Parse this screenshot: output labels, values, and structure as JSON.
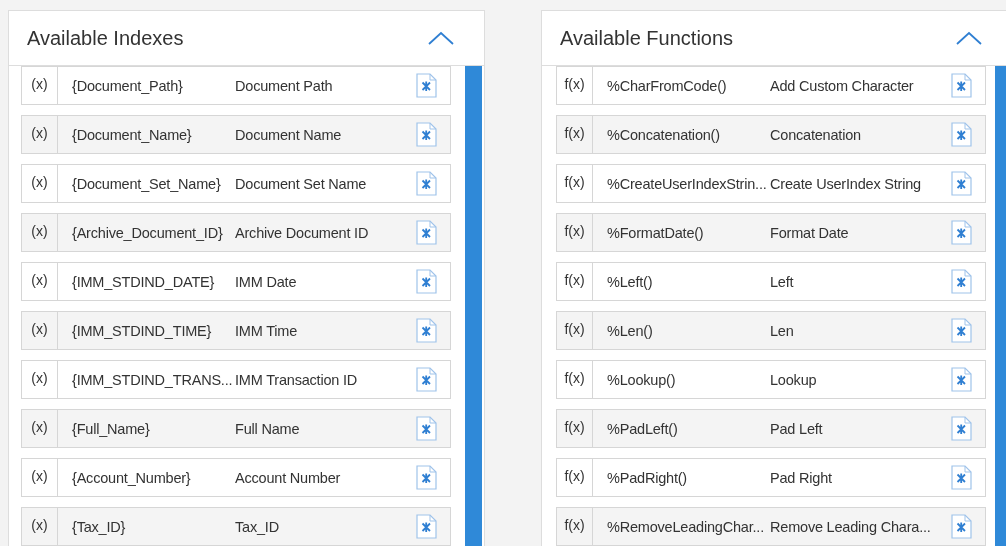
{
  "panels": [
    {
      "title": "Available Indexes",
      "kind": "indexes",
      "items": [
        {
          "prefix": "(x)",
          "name": "{Document_Path}",
          "description": "Document Path"
        },
        {
          "prefix": "(x)",
          "name": "{Document_Name}",
          "description": "Document Name"
        },
        {
          "prefix": "(x)",
          "name": "{Document_Set_Name}",
          "description": "Document Set Name"
        },
        {
          "prefix": "(x)",
          "name": "{Archive_Document_ID}",
          "description": "Archive Document ID"
        },
        {
          "prefix": "(x)",
          "name": "{IMM_STDIND_DATE}",
          "description": "IMM Date"
        },
        {
          "prefix": "(x)",
          "name": "{IMM_STDIND_TIME}",
          "description": "IMM Time"
        },
        {
          "prefix": "(x)",
          "name": "{IMM_STDIND_TRANS...",
          "description": "IMM Transaction ID"
        },
        {
          "prefix": "(x)",
          "name": "{Full_Name}",
          "description": "Full Name"
        },
        {
          "prefix": "(x)",
          "name": "{Account_Number}",
          "description": "Account Number"
        },
        {
          "prefix": "(x)",
          "name": "{Tax_ID}",
          "description": "Tax_ID"
        }
      ]
    },
    {
      "title": "Available Functions",
      "kind": "functions",
      "items": [
        {
          "prefix": "f(x)",
          "name": "%CharFromCode()",
          "description": "Add Custom Character"
        },
        {
          "prefix": "f(x)",
          "name": "%Concatenation()",
          "description": "Concatenation"
        },
        {
          "prefix": "f(x)",
          "name": "%CreateUserIndexStrin...",
          "description": "Create UserIndex String"
        },
        {
          "prefix": "f(x)",
          "name": "%FormatDate()",
          "description": "Format Date"
        },
        {
          "prefix": "f(x)",
          "name": "%Left()",
          "description": "Left"
        },
        {
          "prefix": "f(x)",
          "name": "%Len()",
          "description": "Len"
        },
        {
          "prefix": "f(x)",
          "name": "%Lookup()",
          "description": "Lookup"
        },
        {
          "prefix": "f(x)",
          "name": "%PadLeft()",
          "description": "Pad Left"
        },
        {
          "prefix": "f(x)",
          "name": "%PadRight()",
          "description": "Pad Right"
        },
        {
          "prefix": "f(x)",
          "name": "%RemoveLeadingChar...",
          "description": "Remove Leading Chara..."
        }
      ]
    }
  ]
}
